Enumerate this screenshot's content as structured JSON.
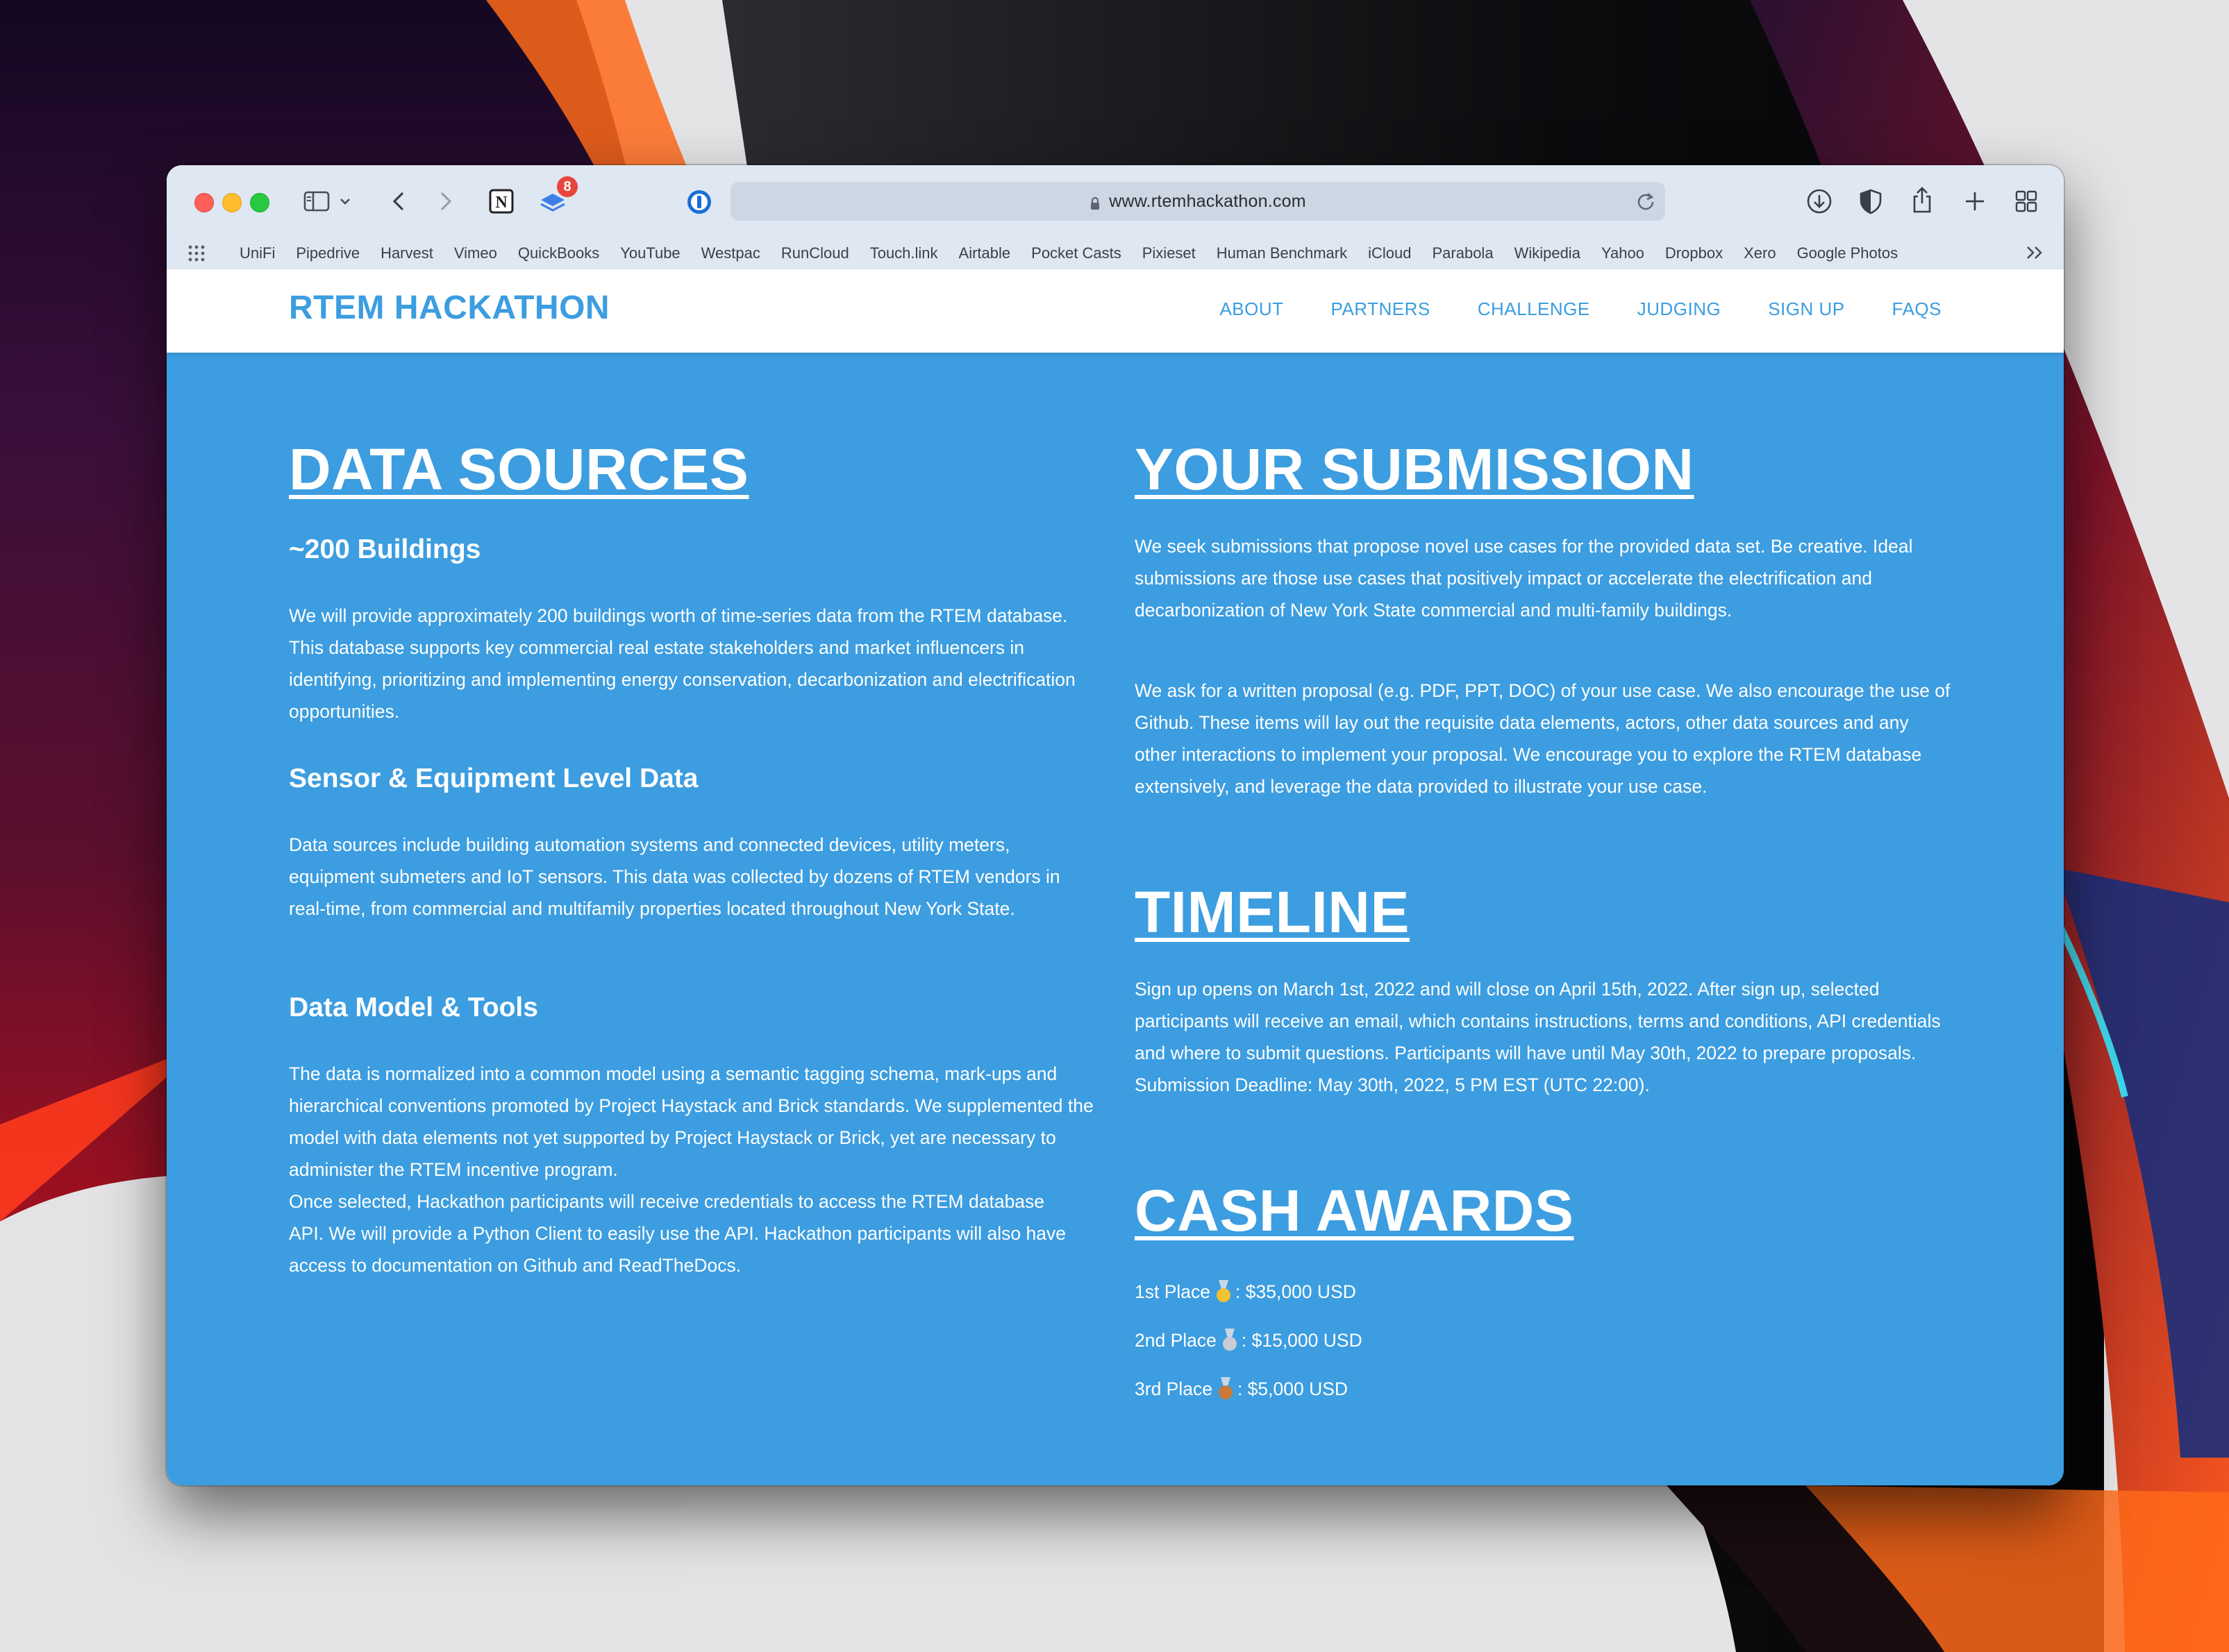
{
  "browser": {
    "url": "www.rtemhackathon.com",
    "extension_badge": "8",
    "bookmarks": [
      "UniFi",
      "Pipedrive",
      "Harvest",
      "Vimeo",
      "QuickBooks",
      "YouTube",
      "Westpac",
      "RunCloud",
      "Touch.link",
      "Airtable",
      "Pocket Casts",
      "Pixieset",
      "Human Benchmark",
      "iCloud",
      "Parabola",
      "Wikipedia",
      "Yahoo",
      "Dropbox",
      "Xero",
      "Google Photos"
    ],
    "icons": [
      "sidebar-icon",
      "chevron-down-icon",
      "back-icon",
      "forward-icon",
      "notion-icon",
      "layers-icon",
      "onepassword-icon",
      "lock-icon",
      "reload-icon",
      "download-icon",
      "shield-icon",
      "share-icon",
      "plus-icon",
      "tabs-overview-icon",
      "apps-grid-icon",
      "more-bookmarks-icon"
    ]
  },
  "site": {
    "logo": "RTEM HACKATHON",
    "nav": [
      "ABOUT",
      "PARTNERS",
      "CHALLENGE",
      "JUDGING",
      "SIGN UP",
      "FAQS"
    ],
    "accent_color": "#3c9de0"
  },
  "data_sources": {
    "title": "DATA SOURCES",
    "sections": [
      {
        "heading": "~200 Buildings",
        "paragraphs": [
          "We will provide approximately 200 buildings worth of time-series data from the RTEM database. This database supports key commercial real estate stakeholders and market influencers in identifying, prioritizing and implementing energy conservation, decarbonization and electrification opportunities."
        ]
      },
      {
        "heading": "Sensor & Equipment Level Data",
        "paragraphs": [
          "Data sources include building automation systems and connected devices, utility meters, equipment submeters and IoT sensors. This data was collected by dozens of RTEM vendors in real-time, from commercial and multifamily properties located throughout New York State."
        ]
      },
      {
        "heading": "Data Model & Tools",
        "paragraphs": [
          "The data is normalized into a common model using a semantic tagging schema, mark-ups and hierarchical conventions promoted by Project Haystack and Brick standards. We supplemented the model with data elements not yet supported by Project Haystack or Brick, yet are necessary to administer the RTEM incentive program.",
          "Once selected, Hackathon participants will receive credentials to access the RTEM database API. We will provide a Python Client to easily use the API. Hackathon participants will also have access to documentation on Github and ReadTheDocs."
        ]
      }
    ]
  },
  "submission": {
    "title": "YOUR SUBMISSION",
    "paragraphs": [
      "We seek submissions that propose novel use cases for the provided data set. Be creative. Ideal submissions are those use cases that positively impact or accelerate the electrification and decarbonization of New York State commercial and multi-family buildings.",
      "We ask for a written proposal (e.g. PDF, PPT, DOC) of your use case. We also encourage the use of Github. These items will lay out the requisite data elements, actors, other data sources and any other interactions to implement your proposal. We encourage you to explore the RTEM database extensively, and leverage the data provided to illustrate your use case."
    ]
  },
  "timeline": {
    "title": "TIMELINE",
    "paragraph": "Sign up opens on March 1st, 2022 and will close on April 15th, 2022. After sign up, selected participants will receive an email, which contains instructions, terms and conditions, API credentials and where to submit questions. Participants will have until May 30th, 2022 to prepare proposals. Submission Deadline: May 30th, 2022, 5 PM EST (UTC 22:00)."
  },
  "awards": {
    "title": "CASH AWARDS",
    "items": [
      {
        "place": "1st Place",
        "amount": ": $35,000 USD",
        "medal_color": "#f2c230"
      },
      {
        "place": "2nd Place",
        "amount": ": $15,000 USD",
        "medal_color": "#c9ccd3"
      },
      {
        "place": "3rd Place",
        "amount": ": $5,000 USD",
        "medal_color": "#c77a3a"
      }
    ]
  }
}
